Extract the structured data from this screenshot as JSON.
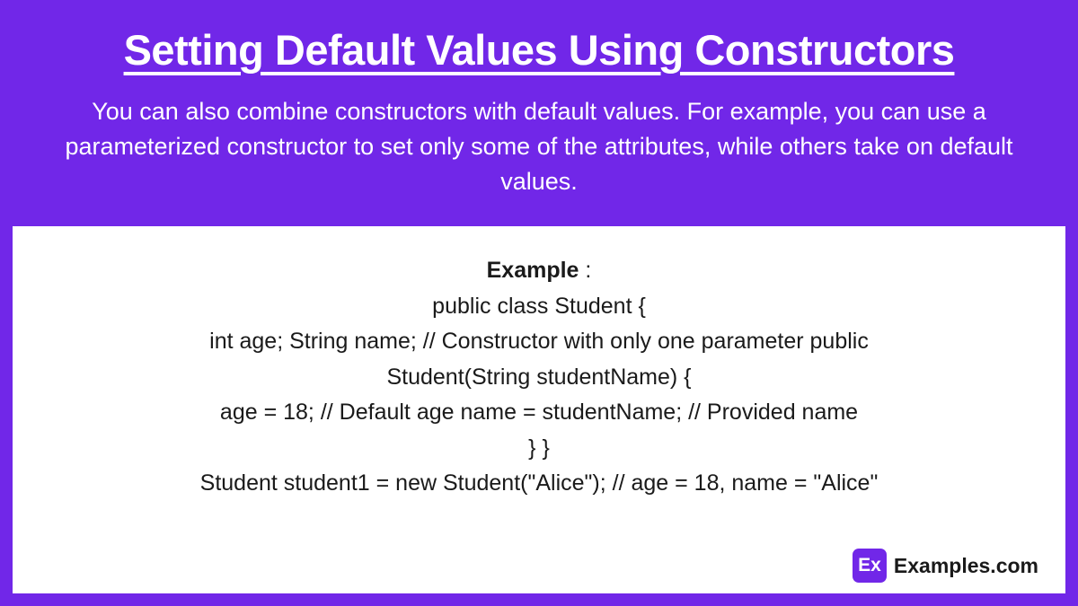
{
  "header": {
    "title": "Setting Default Values Using Constructors",
    "description": "You can also combine constructors with default values. For example, you can use a parameterized constructor to set only some of the attributes, while others take on default values."
  },
  "example": {
    "label": "Example",
    "colon": " :",
    "lines": [
      "public class Student {",
      "int age; String name; // Constructor with only one parameter public",
      "Student(String studentName) {",
      "age = 18; // Default age name = studentName; // Provided name",
      "} }",
      "Student student1 = new Student(\"Alice\"); // age = 18, name = \"Alice\""
    ]
  },
  "logo": {
    "icon_text": "Ex",
    "brand_text": "Examples.com"
  }
}
